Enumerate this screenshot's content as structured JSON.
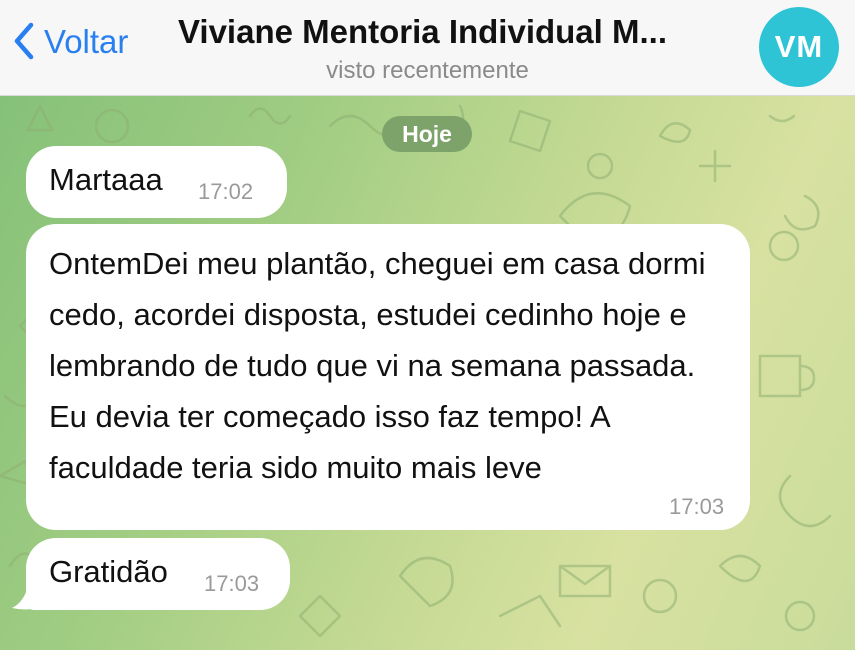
{
  "header": {
    "back_label": "Voltar",
    "title": "Viviane Mentoria Individual M...",
    "subtitle": "visto recentemente",
    "avatar_initials": "VM",
    "accent_color": "#2a7ff0",
    "avatar_color": "#2ec4d6"
  },
  "chat": {
    "date_pill": "Hoje",
    "messages": [
      {
        "text": "Martaaa",
        "time": "17:02"
      },
      {
        "text": "OntemDei meu plantão, cheguei em casa dormi cedo, acordei disposta, estudei cedinho hoje e lembrando de tudo que vi na semana passada. Eu devia ter começado isso faz tempo! A faculdade teria sido muito mais leve",
        "time": "17:03"
      },
      {
        "text": "Gratidão",
        "time": "17:03"
      }
    ]
  }
}
